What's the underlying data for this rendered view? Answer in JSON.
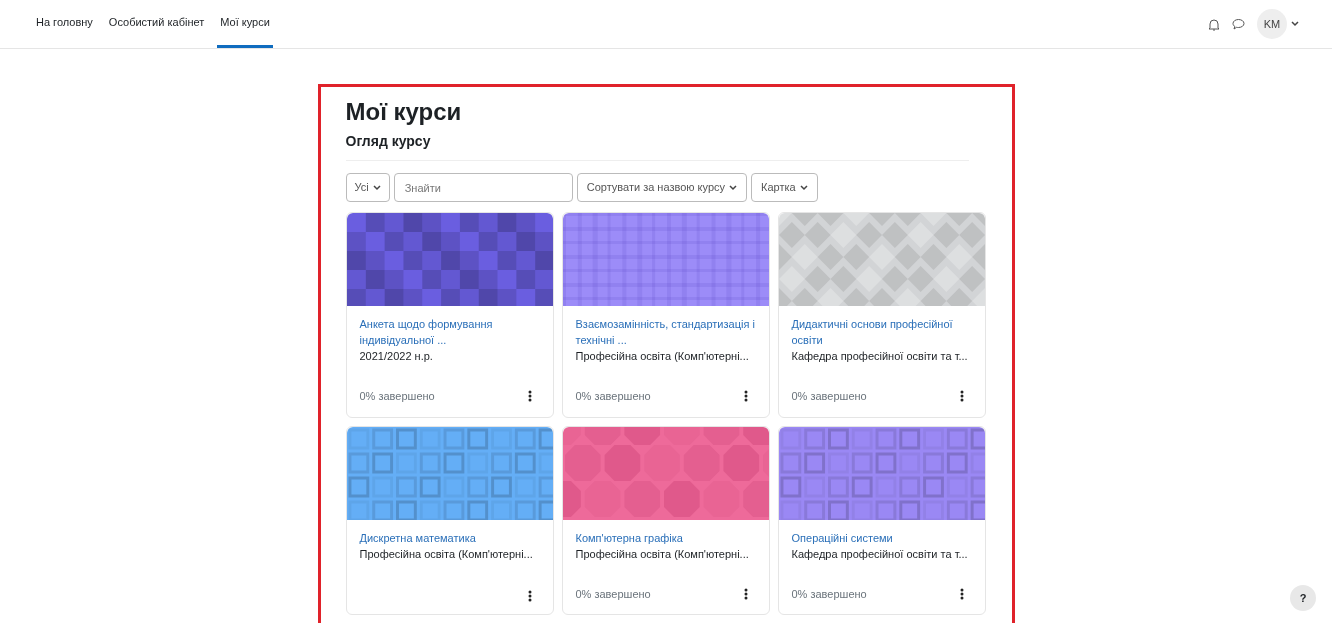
{
  "nav": {
    "items": [
      {
        "label": "На головну",
        "selected": false
      },
      {
        "label": "Особистий кабінет",
        "selected": false
      },
      {
        "label": "Мої курси",
        "selected": true
      }
    ],
    "avatar": "KM"
  },
  "page": {
    "title": "Мої курси",
    "section": "Огляд курсу"
  },
  "filters": {
    "grouping": "Усі",
    "search": {
      "placeholder": "Знайти"
    },
    "sort": "Сортувати за назвою курсу",
    "view": "Картка"
  },
  "courses": [
    {
      "name": "Анкета щодо формування індивідуальної ...",
      "category": "2021/2022 н.р.",
      "progress": "0% завершено",
      "color": "#6a5ee0",
      "kind": "squares"
    },
    {
      "name": "Взаємозамінність, стандартизація і технічні ...",
      "category": "Професійна освіта (Комп'ютерні...",
      "progress": "0% завершено",
      "color": "#9c8cf8",
      "kind": "plaid"
    },
    {
      "name": "Дидактичні основи професійної освіти",
      "category": "Кафедра професійної освіти та т...",
      "progress": "0% завершено",
      "color": "#d2d4d6",
      "kind": "diamonds"
    },
    {
      "name": "Дискретна математика",
      "category": "Професійна освіта (Комп'ютерні...",
      "color": "#64aef6",
      "kind": "boxes"
    },
    {
      "name": "Комп'ютерна графіка",
      "category": "Професійна освіта (Комп'ютерні...",
      "progress": "0% завершено",
      "color": "#ee6a9a",
      "kind": "octagons"
    },
    {
      "name": "Операційні системи",
      "category": "Кафедра професійної освіти та т...",
      "progress": "0% завершено",
      "color": "#9a88f4",
      "kind": "boxes"
    }
  ],
  "help": "?"
}
